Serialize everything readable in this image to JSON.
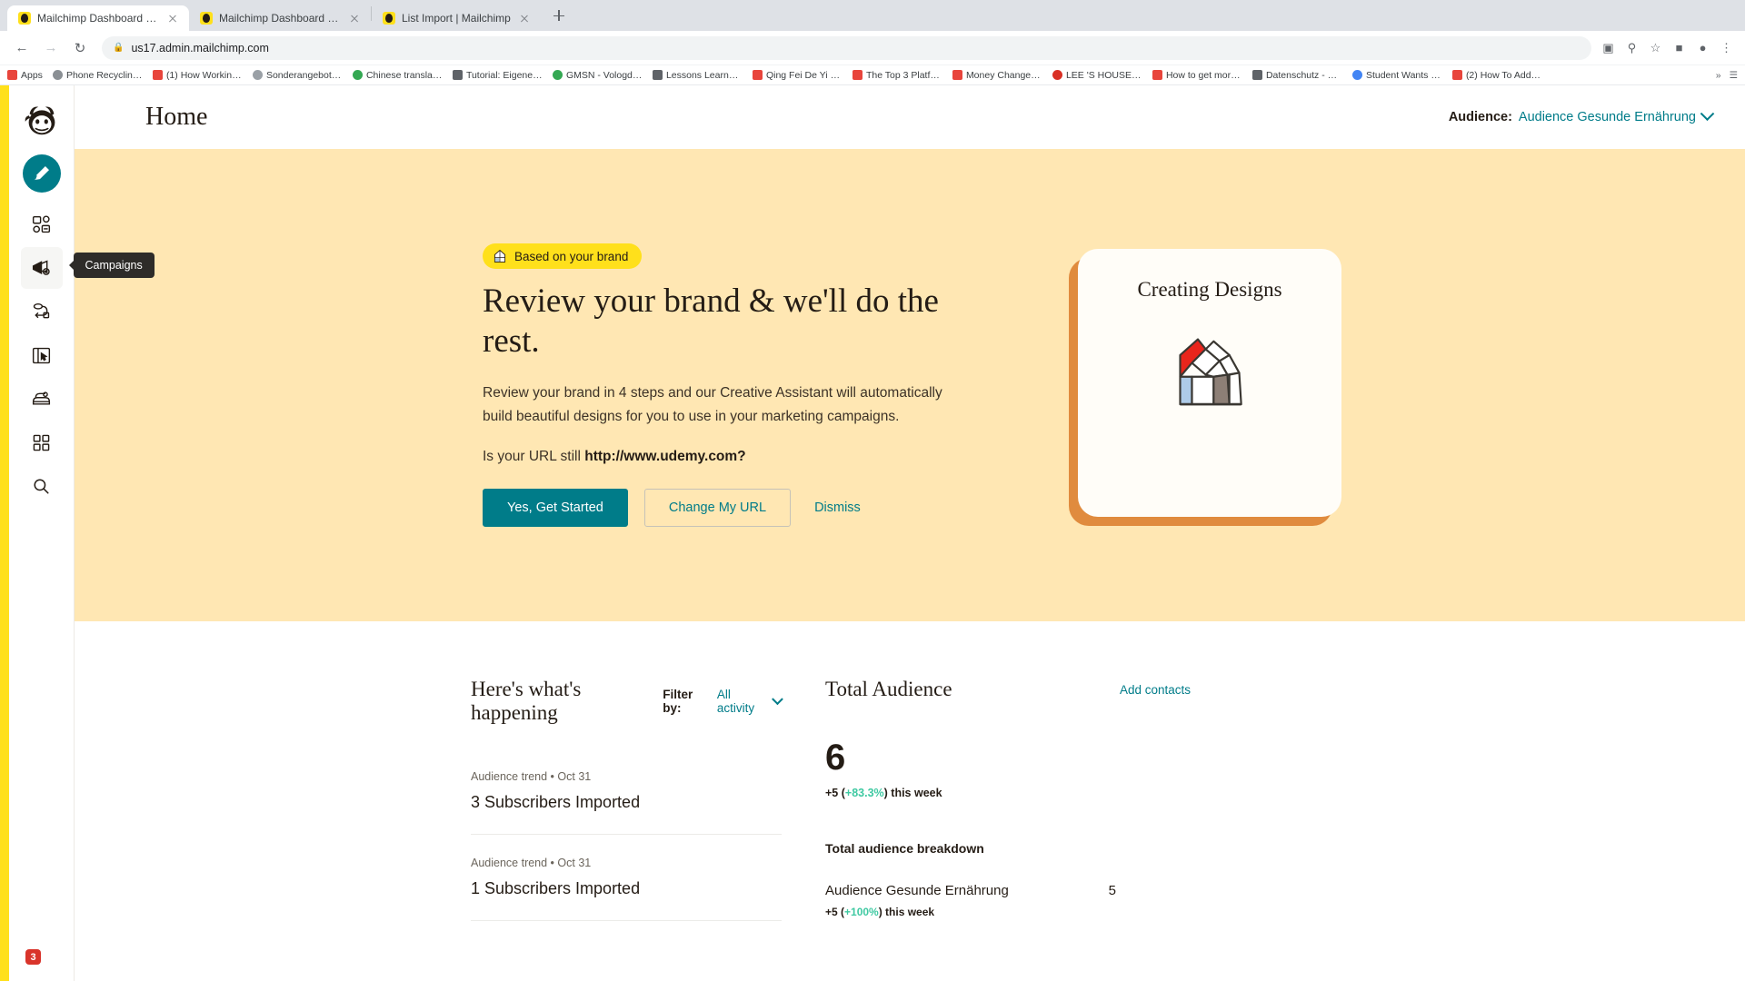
{
  "browser": {
    "tabs": [
      {
        "title": "Mailchimp Dashboard | Mailc...",
        "active": true
      },
      {
        "title": "Mailchimp Dashboard | Mailc...",
        "active": false
      },
      {
        "title": "List Import | Mailchimp",
        "active": false
      }
    ],
    "new_tab_label": "+",
    "nav": {
      "back": "←",
      "forward": "→",
      "reload": "↻"
    },
    "omnibox": {
      "url": "us17.admin.mailchimp.com",
      "lock": "lock-icon"
    },
    "toolbar_icons": [
      "cast-icon",
      "zoom-icon",
      "star-icon",
      "extension-icon",
      "profile-icon",
      "menu-icon"
    ],
    "bookmarks": [
      {
        "label": "Apps",
        "color": "#e8453c"
      },
      {
        "label": "Phone Recycling...",
        "color": "#5f6368"
      },
      {
        "label": "(1) How Working a...",
        "color": "#e8453c"
      },
      {
        "label": "Sonderangebot! |...",
        "color": "#5f6368"
      },
      {
        "label": "Chinese translatio...",
        "color": "#34a853"
      },
      {
        "label": "Tutorial: Eigene Fa...",
        "color": "#5f6368"
      },
      {
        "label": "GMSN - Vologda,...",
        "color": "#34a853"
      },
      {
        "label": "Lessons Learned f...",
        "color": "#5f6368"
      },
      {
        "label": "Qing Fei De Yi - Y...",
        "color": "#e8453c"
      },
      {
        "label": "The Top 3 Platfor...",
        "color": "#e8453c"
      },
      {
        "label": "Money Changes E...",
        "color": "#e8453c"
      },
      {
        "label": "LEE 'S HOUSE'--...",
        "color": "#e8453c"
      },
      {
        "label": "How to get more v...",
        "color": "#e8453c"
      },
      {
        "label": "Datenschutz - Re...",
        "color": "#5f6368"
      },
      {
        "label": "Student Wants an...",
        "color": "#4285f4"
      },
      {
        "label": "(2) How To Add A...",
        "color": "#e8453c"
      }
    ]
  },
  "sidebar": {
    "logo": "mailchimp-logo",
    "create_button": "pencil-icon",
    "items": [
      {
        "name": "audience",
        "icon": "audience-icon",
        "active": false
      },
      {
        "name": "campaigns",
        "icon": "megaphone-icon",
        "active": true,
        "tooltip": "Campaigns"
      },
      {
        "name": "automations",
        "icon": "automation-icon",
        "active": false
      },
      {
        "name": "website",
        "icon": "website-icon",
        "active": false
      },
      {
        "name": "content-studio",
        "icon": "content-icon",
        "active": false
      },
      {
        "name": "integrations",
        "icon": "grid-icon",
        "active": false
      },
      {
        "name": "search",
        "icon": "search-icon",
        "active": false
      }
    ],
    "badge_count": "3"
  },
  "header": {
    "title": "Home",
    "audience_label": "Audience:",
    "audience_value": "Audience Gesunde Ernährung",
    "chevron": "chevron-down-icon"
  },
  "hero": {
    "badge": "Based on your brand",
    "badge_icon": "greenhouse-icon",
    "headline": "Review your brand & we'll do the rest.",
    "body": "Review your brand in 4 steps and our Creative Assistant will automatically build beautiful designs for you to use in your marketing campaigns.",
    "url_prefix": "Is your URL still ",
    "url_value": "http://www.udemy.com?",
    "primary_button": "Yes, Get Started",
    "secondary_button": "Change My URL",
    "dismiss_button": "Dismiss",
    "card_title": "Creating Designs",
    "card_illustration": "greenhouse-illustration",
    "bg_color": "#ffe7b3",
    "badge_color": "#ffe01b",
    "primary_color": "#007c89"
  },
  "feed": {
    "title": "Here's what's happening",
    "filter_label": "Filter by:",
    "filter_value": "All activity",
    "items": [
      {
        "meta": "Audience trend  • Oct 31",
        "text": "3 Subscribers Imported"
      },
      {
        "meta": "Audience trend  • Oct 31",
        "text": "1 Subscribers Imported"
      }
    ]
  },
  "audience": {
    "title": "Total Audience",
    "add_link": "Add contacts",
    "total": "6",
    "delta_prefix": "+5 (",
    "delta_pct": "+83.3%",
    "delta_suffix": ") this week",
    "breakdown_title": "Total audience breakdown",
    "rows": [
      {
        "name": "Audience Gesunde Ernährung",
        "value": "5",
        "delta_prefix": "+5 (",
        "delta_pct": "+100%",
        "delta_suffix": ") this week"
      }
    ],
    "positive_color": "#3fc9a2"
  }
}
